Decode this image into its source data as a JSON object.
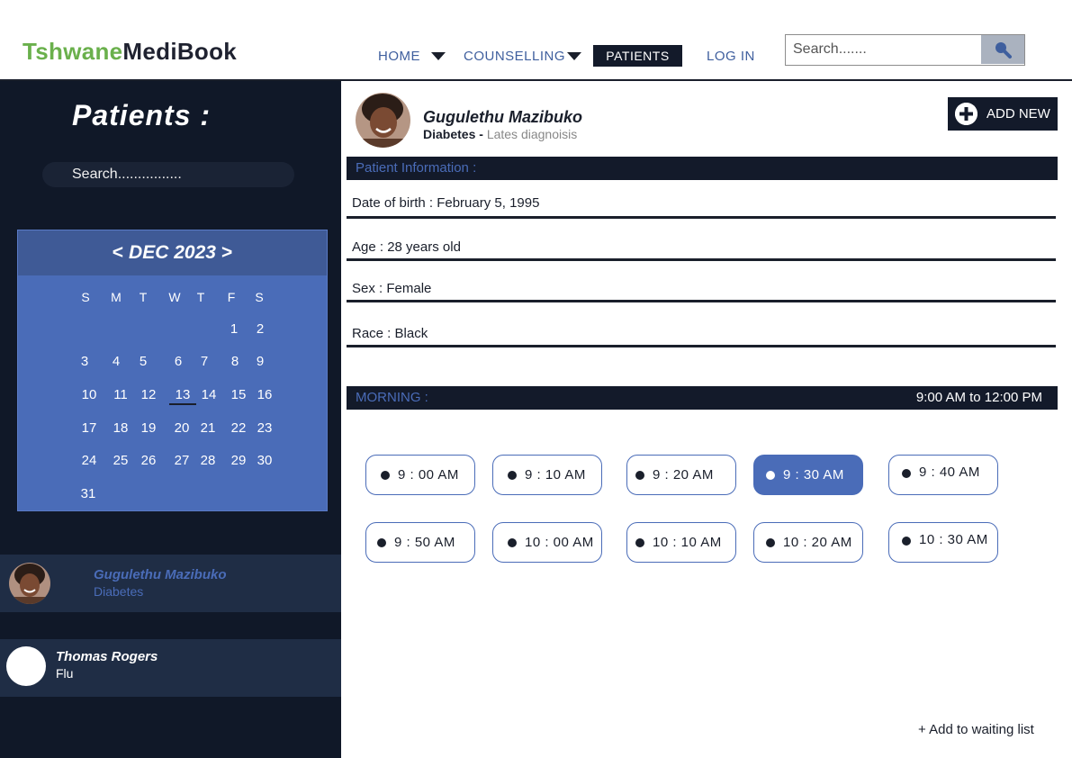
{
  "header": {
    "logo_part1": "Tshwane",
    "logo_part2": "MediBook",
    "nav": {
      "home": "HOME",
      "counselling": "COUNSELLING",
      "patients": "PATIENTS",
      "login": "LOG IN"
    },
    "search_placeholder": "Search......."
  },
  "sidebar": {
    "title": "Patients :",
    "search_placeholder": "Search................",
    "calendar": {
      "prev": "<",
      "month_label": "DEC 2023",
      "next": ">",
      "weekdays": [
        "S",
        "M",
        "T",
        "W",
        "T",
        "F",
        "S"
      ],
      "days": [
        "1",
        "2",
        "3",
        "4",
        "5",
        "6",
        "7",
        "8",
        "9",
        "10",
        "11",
        "12",
        "13",
        "14",
        "15",
        "16",
        "17",
        "18",
        "19",
        "20",
        "21",
        "22",
        "23",
        "24",
        "25",
        "26",
        "27",
        "28",
        "29",
        "30",
        "31"
      ],
      "selected_day": "13"
    },
    "patients": [
      {
        "name": "Gugulethu Mazibuko",
        "diagnosis": "Diabetes"
      },
      {
        "name": "Thomas Rogers",
        "diagnosis": "Flu"
      }
    ]
  },
  "main": {
    "patient_name": "Gugulethu Mazibuko",
    "patient_diagnosis": "Diabetes",
    "diagnosis_separator": " - ",
    "diagnosis_note": "Lates diagnoisis",
    "add_new_label": "ADD NEW",
    "info_header": "Patient Information :",
    "info": {
      "dob": "Date of birth : February 5, 1995",
      "age": "Age : 28 years old",
      "sex": "Sex : Female",
      "race": "Race : Black"
    },
    "schedule": {
      "label": "MORNING :",
      "range": "9:00 AM to 12:00 PM",
      "slots": [
        "9 : 00 AM",
        "9 : 10 AM",
        "9 : 20 AM",
        "9 : 30 AM",
        "9 : 40 AM",
        "9 : 50 AM",
        "10 : 00 AM",
        "10 : 10 AM",
        "10 : 20 AM",
        "10 : 30 AM"
      ],
      "selected_slot": "9 : 30 AM"
    },
    "waitlist_label": "+ Add to waiting list"
  },
  "colors": {
    "brand_green": "#6ab04c",
    "navy": "#131a2a",
    "accent_blue": "#4a6cb8"
  },
  "icons": [
    "chevron-down-icon",
    "search-icon",
    "plus-circle-icon"
  ]
}
